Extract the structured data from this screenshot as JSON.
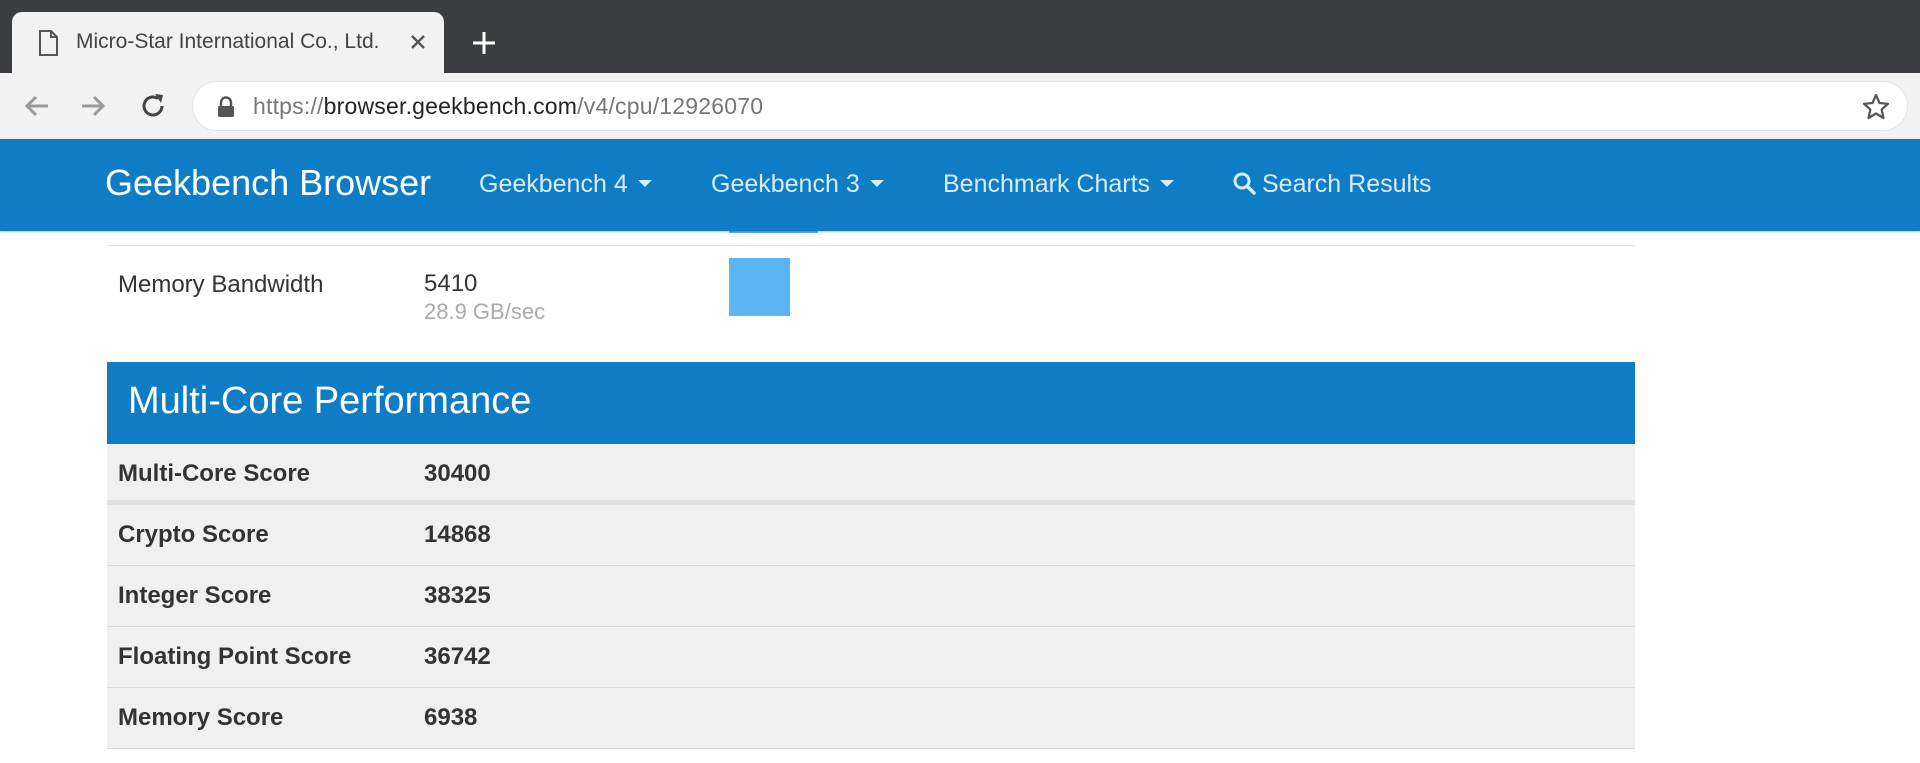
{
  "browser": {
    "tab_title": "Micro-Star International Co., Ltd.",
    "url_scheme": "https://",
    "url_host": "browser.geekbench.com",
    "url_path": "/v4/cpu/12926070"
  },
  "navbar": {
    "brand": "Geekbench Browser",
    "items": [
      {
        "label": "Geekbench 4"
      },
      {
        "label": "Geekbench 3"
      },
      {
        "label": "Benchmark Charts"
      }
    ],
    "search_label": "Search Results"
  },
  "previous_row": {
    "label": "Memory Bandwidth",
    "score": "5410",
    "sub": "28.9 GB/sec"
  },
  "multicore": {
    "title": "Multi-Core Performance",
    "rows": [
      {
        "label": "Multi-Core Score",
        "value": "30400"
      },
      {
        "label": "Crypto Score",
        "value": "14868"
      },
      {
        "label": "Integer Score",
        "value": "38325"
      },
      {
        "label": "Floating Point Score",
        "value": "36742"
      },
      {
        "label": "Memory Score",
        "value": "6938"
      }
    ]
  },
  "colors": {
    "navbar": "#0e7dc5",
    "bar": "#5bb5f5",
    "tabstrip": "#3b3d40"
  }
}
